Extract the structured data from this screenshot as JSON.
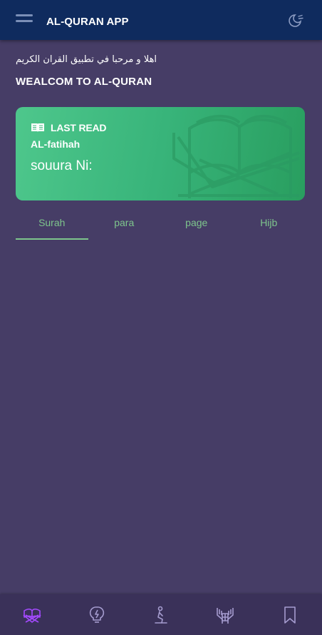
{
  "appbar": {
    "title": "AL-QURAN APP",
    "menu_icon": "menu-icon",
    "theme_icon": "moon-icon"
  },
  "greeting": {
    "arabic": "اهلا و مرحبا في تطبيق القران الكريم",
    "english": "WEALCOM TO AL-QURAN"
  },
  "last_read": {
    "label": "LAST READ",
    "surah": "AL-fatihah",
    "number_label": "souura Ni:",
    "icon": "open-book-icon",
    "background_icon": "quran-stand-icon"
  },
  "tabs": [
    {
      "label": "Surah",
      "active": true
    },
    {
      "label": "para",
      "active": false
    },
    {
      "label": "page",
      "active": false
    },
    {
      "label": "Hijb",
      "active": false
    }
  ],
  "bottom_nav": [
    {
      "icon": "quran-icon",
      "active": true
    },
    {
      "icon": "lightbulb-icon",
      "active": false
    },
    {
      "icon": "prayer-icon",
      "active": false
    },
    {
      "icon": "dua-hands-icon",
      "active": false
    },
    {
      "icon": "bookmark-icon",
      "active": false
    }
  ],
  "colors": {
    "background": "#463d66",
    "appbar": "#0f2b5e",
    "accent_green": "#7ec58c",
    "card_gradient_start": "#4ec78c",
    "card_gradient_end": "#299e5f",
    "nav_active": "#a44aff",
    "nav_inactive": "#a59ccf"
  }
}
